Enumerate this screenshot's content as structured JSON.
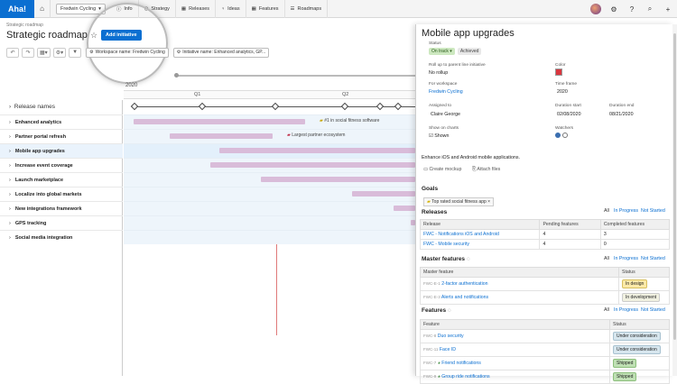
{
  "topbar": {
    "logo": "Aha!",
    "workspace": "Fredwin Cycling",
    "nav": [
      "Info",
      "Strategy",
      "Releases",
      "Ideas",
      "Features",
      "Roadmaps"
    ]
  },
  "page": {
    "breadcrumb": "Strategic roadmap",
    "title": "Strategic roadmap",
    "add_button": "Add initiative"
  },
  "filters": {
    "workspace": "Workspace name: Fredwin Cycling",
    "initiative": "Initiative name: Enhanced analytics, GP..."
  },
  "timeline": {
    "year": "2020",
    "quarters": [
      "Q1",
      "Q2"
    ],
    "release_header": "Release names",
    "rows": [
      {
        "label": "Enhanced analytics",
        "note": "#1 in social fitness software"
      },
      {
        "label": "Partner portal refresh",
        "note": "Largest partner ecosystem"
      },
      {
        "label": "Mobile app upgrades",
        "note": ""
      },
      {
        "label": "Increase event coverage",
        "note": ""
      },
      {
        "label": "Launch marketplace",
        "note": ""
      },
      {
        "label": "Localize into global markets",
        "note": ""
      },
      {
        "label": "New integrations framework",
        "note": ""
      },
      {
        "label": "GPS tracking",
        "note": ""
      },
      {
        "label": "Social media integration",
        "note": ""
      }
    ]
  },
  "panel": {
    "title": "Mobile app upgrades",
    "status_label": "Status",
    "status": "On track",
    "status_alt": "Achieved",
    "color_label": "Color",
    "color": "#d9363e",
    "rollup_label": "Roll up to parent line initiative",
    "rollup": "No rollup",
    "timeframe_label": "Time frame",
    "timeframe": "2020",
    "workspace_label": "For workspace",
    "workspace": "Fredwin Cycling",
    "assigned_label": "Assigned to",
    "assigned": "Claire George",
    "dstart_label": "Duration start",
    "dstart": "02/08/2020",
    "dend_label": "Duration end",
    "dend": "08/21/2020",
    "charts_label": "Show on charts",
    "charts": "Shown",
    "watchers_label": "Watchers",
    "description": "Enhance iOS and Android mobile applications.",
    "create_mockup": "Create mockup",
    "attach_files": "Attach files",
    "goals_title": "Goals",
    "goal": "Top rated social fitness app",
    "filter_all": "All",
    "filter_progress": "In Progress",
    "filter_notstarted": "Not Started",
    "releases_title": "Releases",
    "releases_headers": [
      "Release",
      "Pending features",
      "Completed features"
    ],
    "releases": [
      [
        "FWC - Notifications iOS and Android",
        "4",
        "3"
      ],
      [
        "FWC - Mobile security",
        "4",
        "0"
      ]
    ],
    "master_title": "Master features",
    "master_headers": [
      "Master feature",
      "Status"
    ],
    "master": [
      {
        "id": "FWC-E-1",
        "name": "2-factor authentication",
        "status": "In design"
      },
      {
        "id": "FWC-E-3",
        "name": "Alerts and notifications",
        "status": "In development"
      }
    ],
    "features_title": "Features",
    "features_headers": [
      "Feature",
      "Status"
    ],
    "features": [
      {
        "id": "FWC-8",
        "name": "Duo security",
        "status": "Under consideration"
      },
      {
        "id": "FWC-11",
        "name": "Face ID",
        "status": "Under consideration"
      },
      {
        "id": "FWC-7",
        "name": "Friend notifications",
        "status": "Shipped"
      },
      {
        "id": "FWC-9",
        "name": "Group ride notifications",
        "status": "Shipped"
      }
    ]
  }
}
